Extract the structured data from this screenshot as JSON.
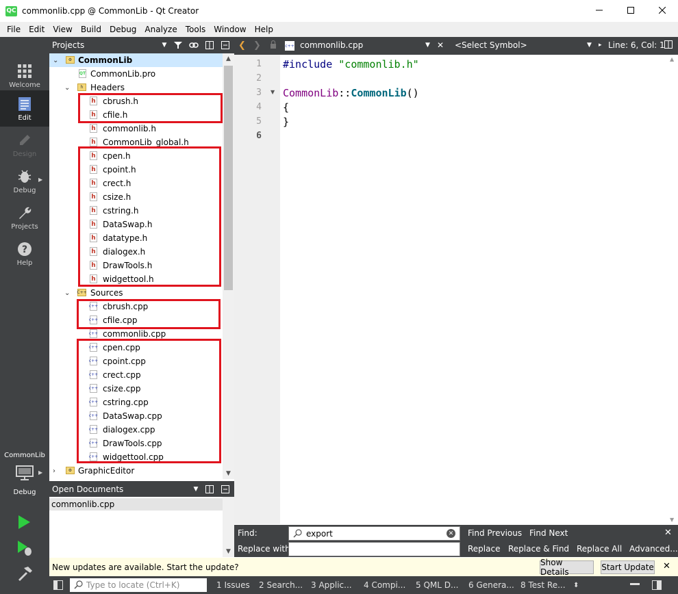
{
  "window": {
    "title": "commonlib.cpp @ CommonLib - Qt Creator",
    "logo": "QC"
  },
  "menu": [
    "File",
    "Edit",
    "View",
    "Build",
    "Debug",
    "Analyze",
    "Tools",
    "Window",
    "Help"
  ],
  "modes": [
    {
      "label": "Welcome",
      "icon": "grid-icon"
    },
    {
      "label": "Edit",
      "icon": "document-icon"
    },
    {
      "label": "Design",
      "icon": "pencil-icon"
    },
    {
      "label": "Debug",
      "icon": "bug-icon"
    },
    {
      "label": "Projects",
      "icon": "wrench-icon"
    },
    {
      "label": "Help",
      "icon": "help-icon"
    }
  ],
  "kit": {
    "project": "CommonLib",
    "label": "Debug"
  },
  "projects_panel": {
    "title": "Projects",
    "tree": [
      {
        "label": "CommonLib",
        "type": "project",
        "indent": 0
      },
      {
        "label": "CommonLib.pro",
        "type": "pro",
        "indent": 1
      },
      {
        "label": "Headers",
        "type": "folder",
        "indent": 1
      },
      {
        "label": "cbrush.h",
        "type": "h",
        "indent": 2
      },
      {
        "label": "cfile.h",
        "type": "h",
        "indent": 2
      },
      {
        "label": "commonlib.h",
        "type": "h",
        "indent": 2
      },
      {
        "label": "CommonLib_global.h",
        "type": "h",
        "indent": 2
      },
      {
        "label": "cpen.h",
        "type": "h",
        "indent": 2
      },
      {
        "label": "cpoint.h",
        "type": "h",
        "indent": 2
      },
      {
        "label": "crect.h",
        "type": "h",
        "indent": 2
      },
      {
        "label": "csize.h",
        "type": "h",
        "indent": 2
      },
      {
        "label": "cstring.h",
        "type": "h",
        "indent": 2
      },
      {
        "label": "DataSwap.h",
        "type": "h",
        "indent": 2
      },
      {
        "label": "datatype.h",
        "type": "h",
        "indent": 2
      },
      {
        "label": "dialogex.h",
        "type": "h",
        "indent": 2
      },
      {
        "label": "DrawTools.h",
        "type": "h",
        "indent": 2
      },
      {
        "label": "widgettool.h",
        "type": "h",
        "indent": 2
      },
      {
        "label": "Sources",
        "type": "folder",
        "indent": 1
      },
      {
        "label": "cbrush.cpp",
        "type": "cpp",
        "indent": 2
      },
      {
        "label": "cfile.cpp",
        "type": "cpp",
        "indent": 2
      },
      {
        "label": "commonlib.cpp",
        "type": "cpp",
        "indent": 2
      },
      {
        "label": "cpen.cpp",
        "type": "cpp",
        "indent": 2
      },
      {
        "label": "cpoint.cpp",
        "type": "cpp",
        "indent": 2
      },
      {
        "label": "crect.cpp",
        "type": "cpp",
        "indent": 2
      },
      {
        "label": "csize.cpp",
        "type": "cpp",
        "indent": 2
      },
      {
        "label": "cstring.cpp",
        "type": "cpp",
        "indent": 2
      },
      {
        "label": "DataSwap.cpp",
        "type": "cpp",
        "indent": 2
      },
      {
        "label": "dialogex.cpp",
        "type": "cpp",
        "indent": 2
      },
      {
        "label": "DrawTools.cpp",
        "type": "cpp",
        "indent": 2
      },
      {
        "label": "widgettool.cpp",
        "type": "cpp",
        "indent": 2
      },
      {
        "label": "GraphicEditor",
        "type": "project",
        "indent": 0
      }
    ]
  },
  "open_documents": {
    "title": "Open Documents",
    "items": [
      "commonlib.cpp"
    ]
  },
  "editor_toolbar": {
    "file": "commonlib.cpp",
    "symbol": "<Select Symbol>",
    "position": "Line: 6, Col: 1"
  },
  "editor": {
    "line_numbers": [
      "1",
      "2",
      "3",
      "4",
      "5",
      "6"
    ],
    "current_line": 6,
    "code": {
      "l1_pre": "#include",
      "l1_str": "\"commonlib.h\"",
      "l3_class": "CommonLib",
      "l3_sep": "::",
      "l3_func": "CommonLib",
      "l3_paren": "()",
      "l4": "{",
      "l5": "}"
    }
  },
  "find_bar": {
    "find_label": "Find:",
    "find_value": "export",
    "replace_label": "Replace with:",
    "find_previous": "Find Previous",
    "find_next": "Find Next",
    "replace": "Replace",
    "replace_find": "Replace & Find",
    "replace_all": "Replace All",
    "advanced": "Advanced..."
  },
  "info_bar": {
    "message": "New updates are available. Start the update?",
    "show_details": "Show Details",
    "start_update": "Start Update"
  },
  "status_bar": {
    "locator_placeholder": "Type to locate (Ctrl+K)",
    "panes": [
      "1  Issues",
      "2  Search...",
      "3  Applic...",
      "4  Compi...",
      "5  QML D...",
      "6  Genera...",
      "8  Test Re..."
    ]
  },
  "colors": {
    "sidebar": "#404244",
    "highlight_box": "#e0141e",
    "selected_row": "#cde8ff"
  }
}
